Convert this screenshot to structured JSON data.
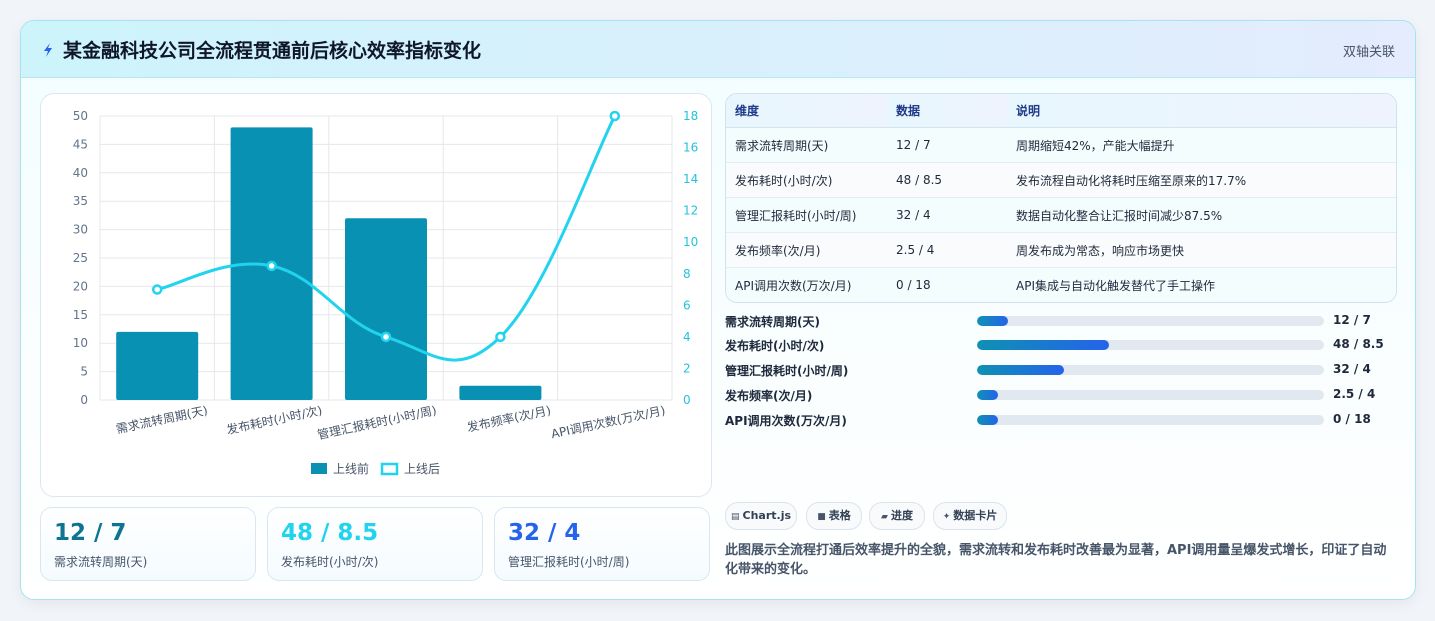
{
  "header": {
    "title": "某金融科技公司全流程贯通前后核心效率指标变化",
    "badge": "双轴关联",
    "icon": "lightning-icon"
  },
  "chart_data": {
    "type": "bar",
    "categories": [
      "需求流转周期(天)",
      "发布耗时(小时/次)",
      "管理汇报耗时(小时/周)",
      "发布频率(次/月)",
      "API调用次数(万次/月)"
    ],
    "series": [
      {
        "name": "上线前",
        "type": "bar",
        "axis": "left",
        "values": [
          12,
          48,
          32,
          2.5,
          0
        ],
        "color": "#0891b2"
      },
      {
        "name": "上线后",
        "type": "line",
        "axis": "right",
        "values": [
          7,
          8.5,
          4,
          4,
          18
        ],
        "color": "#22d3ee"
      }
    ],
    "y_left": {
      "min": 0,
      "max": 50,
      "ticks": [
        0,
        5,
        10,
        15,
        20,
        25,
        30,
        35,
        40,
        45,
        50
      ]
    },
    "y_right": {
      "min": 0,
      "max": 18,
      "ticks": [
        0,
        2,
        4,
        6,
        8,
        10,
        12,
        14,
        16,
        18
      ]
    },
    "legend_position": "bottom",
    "grid": true
  },
  "kpis": [
    {
      "value": "12 / 7",
      "label": "需求流转周期(天)",
      "color": "#0e7490"
    },
    {
      "value": "48 / 8.5",
      "label": "发布耗时(小时/次)",
      "color": "#22d3ee"
    },
    {
      "value": "32 / 4",
      "label": "管理汇报耗时(小时/周)",
      "color": "#2563eb"
    }
  ],
  "table": {
    "headers": [
      "维度",
      "数据",
      "说明"
    ],
    "rows": [
      [
        "需求流转周期(天)",
        "12 / 7",
        "周期缩短42%，产能大幅提升"
      ],
      [
        "发布耗时(小时/次)",
        "48 / 8.5",
        "发布流程自动化将耗时压缩至原来的17.7%"
      ],
      [
        "管理汇报耗时(小时/周)",
        "32 / 4",
        "数据自动化整合让汇报时间减少87.5%"
      ],
      [
        "发布频率(次/月)",
        "2.5 / 4",
        "周发布成为常态，响应市场更快"
      ],
      [
        "API调用次数(万次/月)",
        "0 / 18",
        "API集成与自动化触发替代了手工操作"
      ]
    ]
  },
  "progress": [
    {
      "label": "需求流转周期(天)",
      "value": "12 / 7",
      "fill": 0.09
    },
    {
      "label": "发布耗时(小时/次)",
      "value": "48 / 8.5",
      "fill": 0.38
    },
    {
      "label": "管理汇报耗时(小时/周)",
      "value": "32 / 4",
      "fill": 0.25
    },
    {
      "label": "发布频率(次/月)",
      "value": "2.5 / 4",
      "fill": 0.06
    },
    {
      "label": "API调用次数(万次/月)",
      "value": "0 / 18",
      "fill": 0.06
    }
  ],
  "tags": [
    {
      "icon": "chart-icon",
      "glyph": "▤",
      "label": "Chart.js"
    },
    {
      "icon": "table-icon",
      "glyph": "■",
      "label": "表格"
    },
    {
      "icon": "folder-icon",
      "glyph": "▰",
      "label": "进度"
    },
    {
      "icon": "sparkle-icon",
      "glyph": "✦",
      "label": "数据卡片"
    }
  ],
  "description": "此图展示全流程打通后效率提升的全貌，需求流转和发布耗时改善最为显著，API调用量呈爆发式增长，印证了自动化带来的变化。"
}
